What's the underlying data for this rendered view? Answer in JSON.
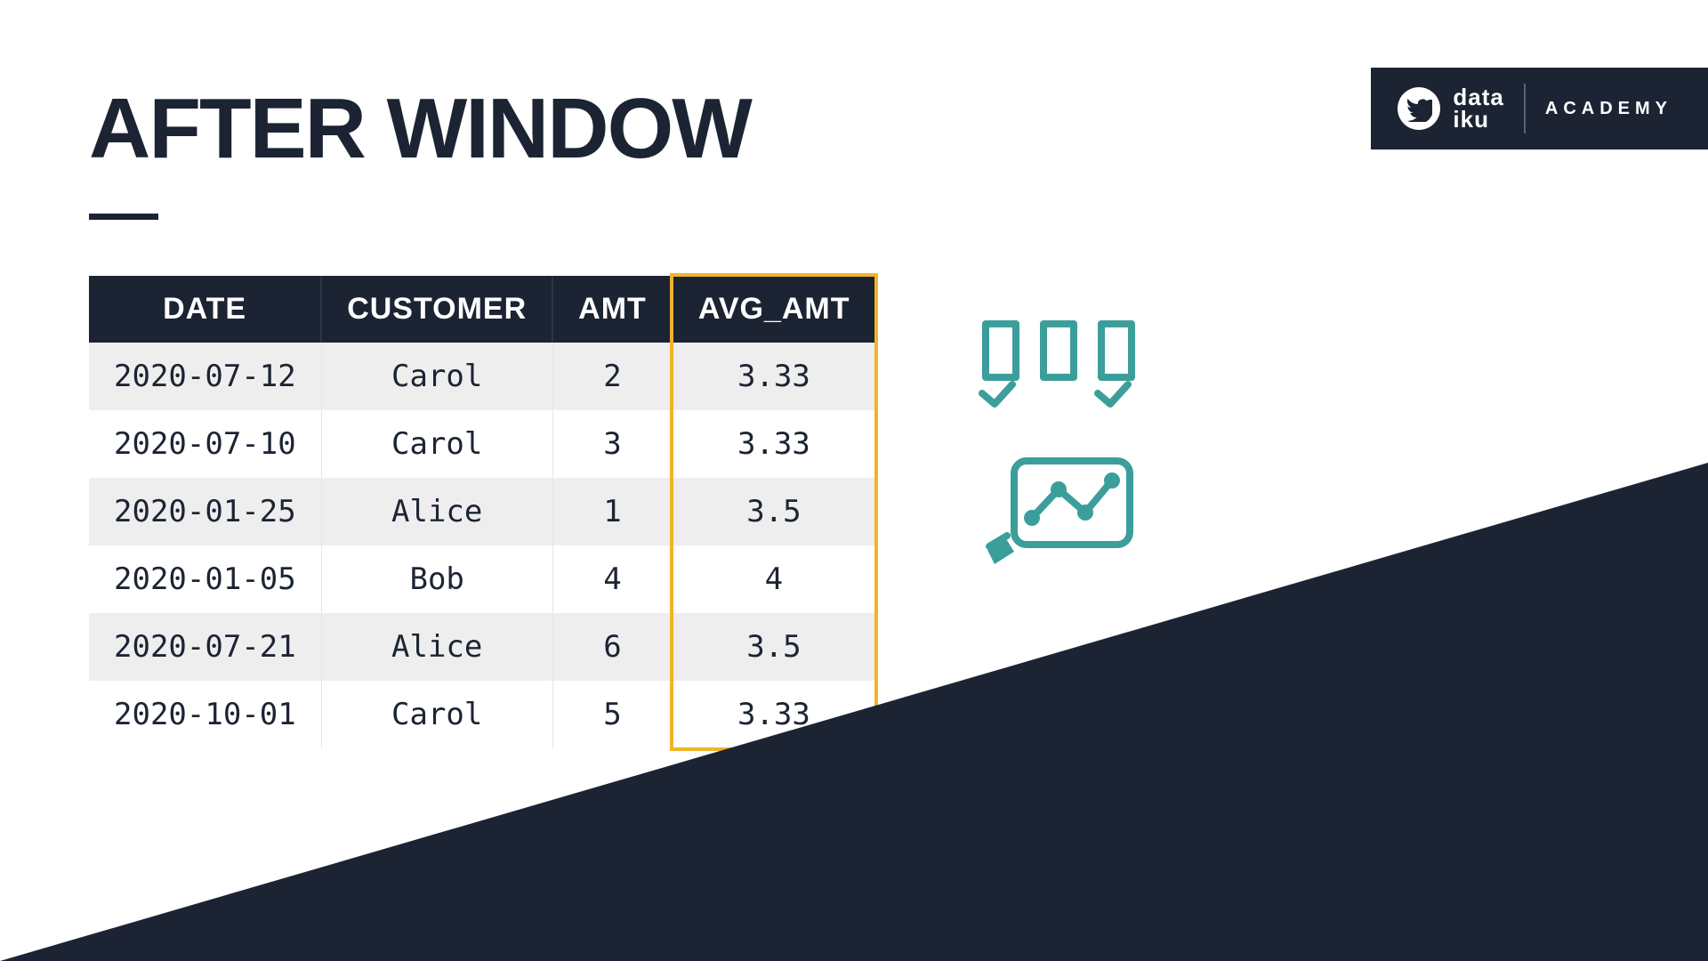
{
  "brand": {
    "word1": "data",
    "word2": "iku",
    "academy": "ACADEMY"
  },
  "title": "AFTER WINDOW",
  "table": {
    "headers": [
      "DATE",
      "CUSTOMER",
      "AMT",
      "AVG_AMT"
    ],
    "rows": [
      [
        "2020-07-12",
        "Carol",
        "2",
        "3.33"
      ],
      [
        "2020-07-10",
        "Carol",
        "3",
        "3.33"
      ],
      [
        "2020-01-25",
        "Alice",
        "1",
        "3.5"
      ],
      [
        "2020-01-05",
        "Bob",
        "4",
        "4"
      ],
      [
        "2020-07-21",
        "Alice",
        "6",
        "3.5"
      ],
      [
        "2020-10-01",
        "Carol",
        "5",
        "3.33"
      ]
    ],
    "highlight_col": 3
  },
  "colors": {
    "brand_bg": "#1c2434",
    "teal": "#3c9e9b",
    "highlight": "#f0b429"
  }
}
